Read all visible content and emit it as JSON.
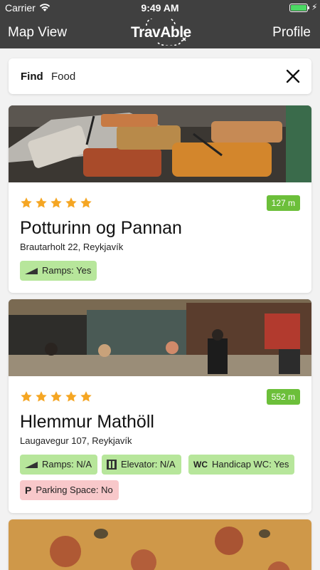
{
  "status_bar": {
    "carrier": "Carrier",
    "time": "9:49 AM"
  },
  "nav": {
    "left": "Map View",
    "logo": "TravAble",
    "right": "Profile"
  },
  "search": {
    "label": "Find",
    "value": "Food"
  },
  "colors": {
    "header": "#404040",
    "green_tag": "#b7e69b",
    "red_tag": "#f8c8ca",
    "distance": "#6cbf3a",
    "star": "#f5a623"
  },
  "cards": [
    {
      "rating": 5,
      "distance": "127 m",
      "name": "Potturinn og Pannan",
      "address": "Brautarholt 22, Reykjavík",
      "tags": [
        {
          "icon": "ramp-icon",
          "text": "Ramps: Yes",
          "status": "green"
        }
      ]
    },
    {
      "rating": 5,
      "distance": "552 m",
      "name": "Hlemmur Mathöll",
      "address": "Laugavegur 107, Reykjavík",
      "tags": [
        {
          "icon": "ramp-icon",
          "text": "Ramps: N/A",
          "status": "green"
        },
        {
          "icon": "elevator-icon",
          "text": "Elevator: N/A",
          "status": "green"
        },
        {
          "icon": "wc-icon",
          "text": "Handicap WC: Yes",
          "status": "green"
        },
        {
          "icon": "parking-icon",
          "text": "Parking Space: No",
          "status": "red"
        }
      ]
    }
  ]
}
